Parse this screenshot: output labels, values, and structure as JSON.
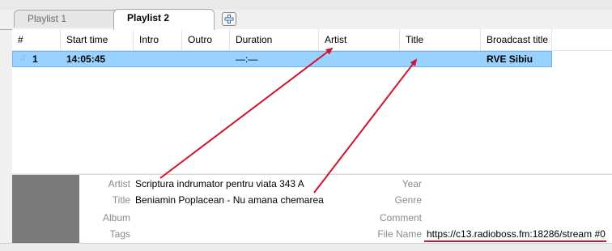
{
  "tabs": [
    {
      "label": "Playlist 1"
    },
    {
      "label": "Playlist 2"
    }
  ],
  "columns": [
    "#",
    "Start time",
    "Intro",
    "Outro",
    "Duration",
    "Artist",
    "Title",
    "Broadcast title"
  ],
  "row": {
    "number": "1",
    "start_time": "14:05:45",
    "intro": "",
    "outro": "",
    "duration": "—:—",
    "artist": "",
    "title": "",
    "broadcast_title": "RVE Sibiu"
  },
  "info": {
    "artist_label": "Artist",
    "artist_value": "Scriptura indrumator pentru viata 343 A",
    "title_label": "Title",
    "title_value": "Beniamin Poplacean - Nu amana chemarea",
    "album_label": "Album",
    "tags_label": "Tags",
    "year_label": "Year",
    "genre_label": "Genre",
    "comment_label": "Comment",
    "filename_label": "File Name",
    "filename_value": "https://c13.radioboss.fm:18286/stream #0"
  },
  "colors": {
    "selection": "#99d1ff",
    "annotation": "#d0142c"
  },
  "icons": [
    "plus-icon",
    "music-note-icon"
  ]
}
